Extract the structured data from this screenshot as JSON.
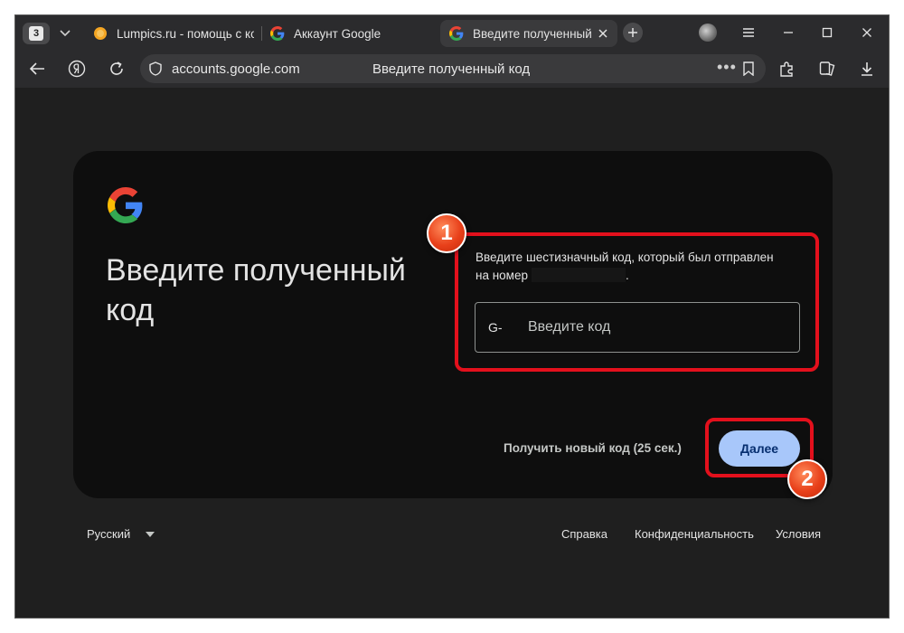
{
  "tabs": {
    "counter": "3",
    "items": [
      {
        "label": "Lumpics.ru - помощь с ко"
      },
      {
        "label": "Аккаунт Google"
      },
      {
        "label": "Введите полученный к"
      }
    ]
  },
  "addressbar": {
    "url": "accounts.google.com",
    "page_title": "Введите полученный код",
    "dots": "•••"
  },
  "page": {
    "heading": "Введите полученный код",
    "instruction_line1": "Введите шестизначный код, который был отправлен",
    "instruction_line2": "на номер",
    "instruction_end": ".",
    "code_prefix": "G-",
    "code_placeholder": "Введите код",
    "code_value": "",
    "resend_label": "Получить новый код (25 сек.)",
    "next_label": "Далее"
  },
  "footer": {
    "language": "Русский",
    "links": [
      "Справка",
      "Конфиденциальность",
      "Условия"
    ]
  },
  "annotations": [
    "1",
    "2"
  ],
  "colors": {
    "accent": "#a8c7fa",
    "annotation_red": "#e3101c",
    "card_bg": "#0e0e0e",
    "page_bg": "#1f1f1f"
  }
}
